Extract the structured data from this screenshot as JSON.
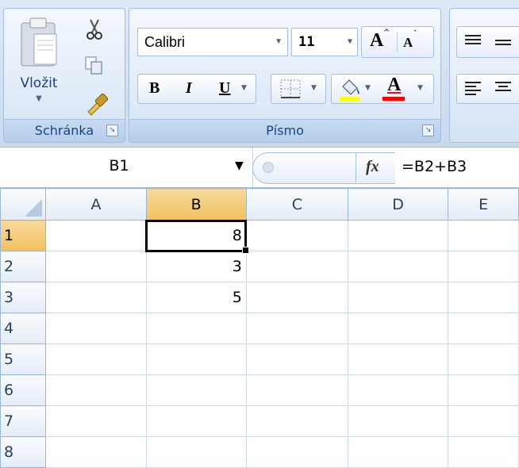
{
  "ribbon": {
    "clipboard": {
      "paste_label": "Vložit",
      "group_label": "Schránka",
      "launcher_icon": "dialog-launcher-icon"
    },
    "font": {
      "font_name": "Calibri",
      "font_size": "11",
      "grow_label": "A",
      "shrink_label": "A",
      "bold_label": "B",
      "italic_label": "I",
      "underline_label": "U",
      "font_color_label": "A",
      "group_label": "Písmo",
      "fill_color": "#ffff00",
      "text_color": "#ff0000"
    }
  },
  "formula_bar": {
    "name_box": "B1",
    "fx_label": "fx",
    "formula": "=B2+B3"
  },
  "grid": {
    "columns": [
      "A",
      "B",
      "C",
      "D",
      "E"
    ],
    "rows": [
      {
        "num": "1",
        "B": "8"
      },
      {
        "num": "2",
        "B": "3"
      },
      {
        "num": "3",
        "B": "5"
      },
      {
        "num": "4",
        "B": ""
      },
      {
        "num": "5",
        "B": ""
      },
      {
        "num": "6",
        "B": ""
      },
      {
        "num": "7",
        "B": ""
      },
      {
        "num": "8",
        "B": ""
      }
    ]
  }
}
